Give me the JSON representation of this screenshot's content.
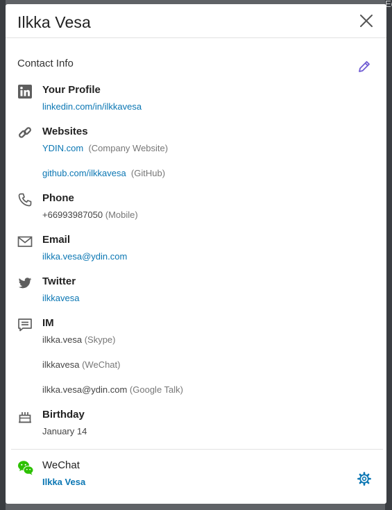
{
  "background": {
    "edit_fragment": "Edit"
  },
  "modal": {
    "title": "Ilkka Vesa",
    "section_title": "Contact Info"
  },
  "profile": {
    "label": "Your Profile",
    "url": "linkedin.com/in/ilkkavesa"
  },
  "websites": {
    "label": "Websites",
    "items": [
      {
        "url": "YDIN.com",
        "note": "(Company Website)"
      },
      {
        "url": "github.com/ilkkavesa",
        "note": "(GitHub)"
      }
    ]
  },
  "phone": {
    "label": "Phone",
    "number": "+66993987050",
    "note": "(Mobile)"
  },
  "email": {
    "label": "Email",
    "address": "ilkka.vesa@ydin.com"
  },
  "twitter": {
    "label": "Twitter",
    "handle": "ilkkavesa"
  },
  "im": {
    "label": "IM",
    "items": [
      {
        "handle": "ilkka.vesa",
        "note": "(Skype)"
      },
      {
        "handle": "ilkkavesa",
        "note": "(WeChat)"
      },
      {
        "handle": "ilkka.vesa@ydin.com",
        "note": "(Google Talk)"
      }
    ]
  },
  "birthday": {
    "label": "Birthday",
    "date": "January 14"
  },
  "wechat": {
    "label": "WeChat",
    "name": "Ilkka Vesa"
  },
  "colors": {
    "link": "#0a76b3",
    "edit_pencil": "#6f5bd3",
    "wechat_green": "#2dc100",
    "icon_gray": "#5e5e5e"
  },
  "icons": [
    "close-icon",
    "pencil-icon",
    "linkedin-icon",
    "link-icon",
    "phone-icon",
    "envelope-icon",
    "twitter-icon",
    "chat-icon",
    "cake-icon",
    "wechat-icon",
    "gear-icon"
  ]
}
